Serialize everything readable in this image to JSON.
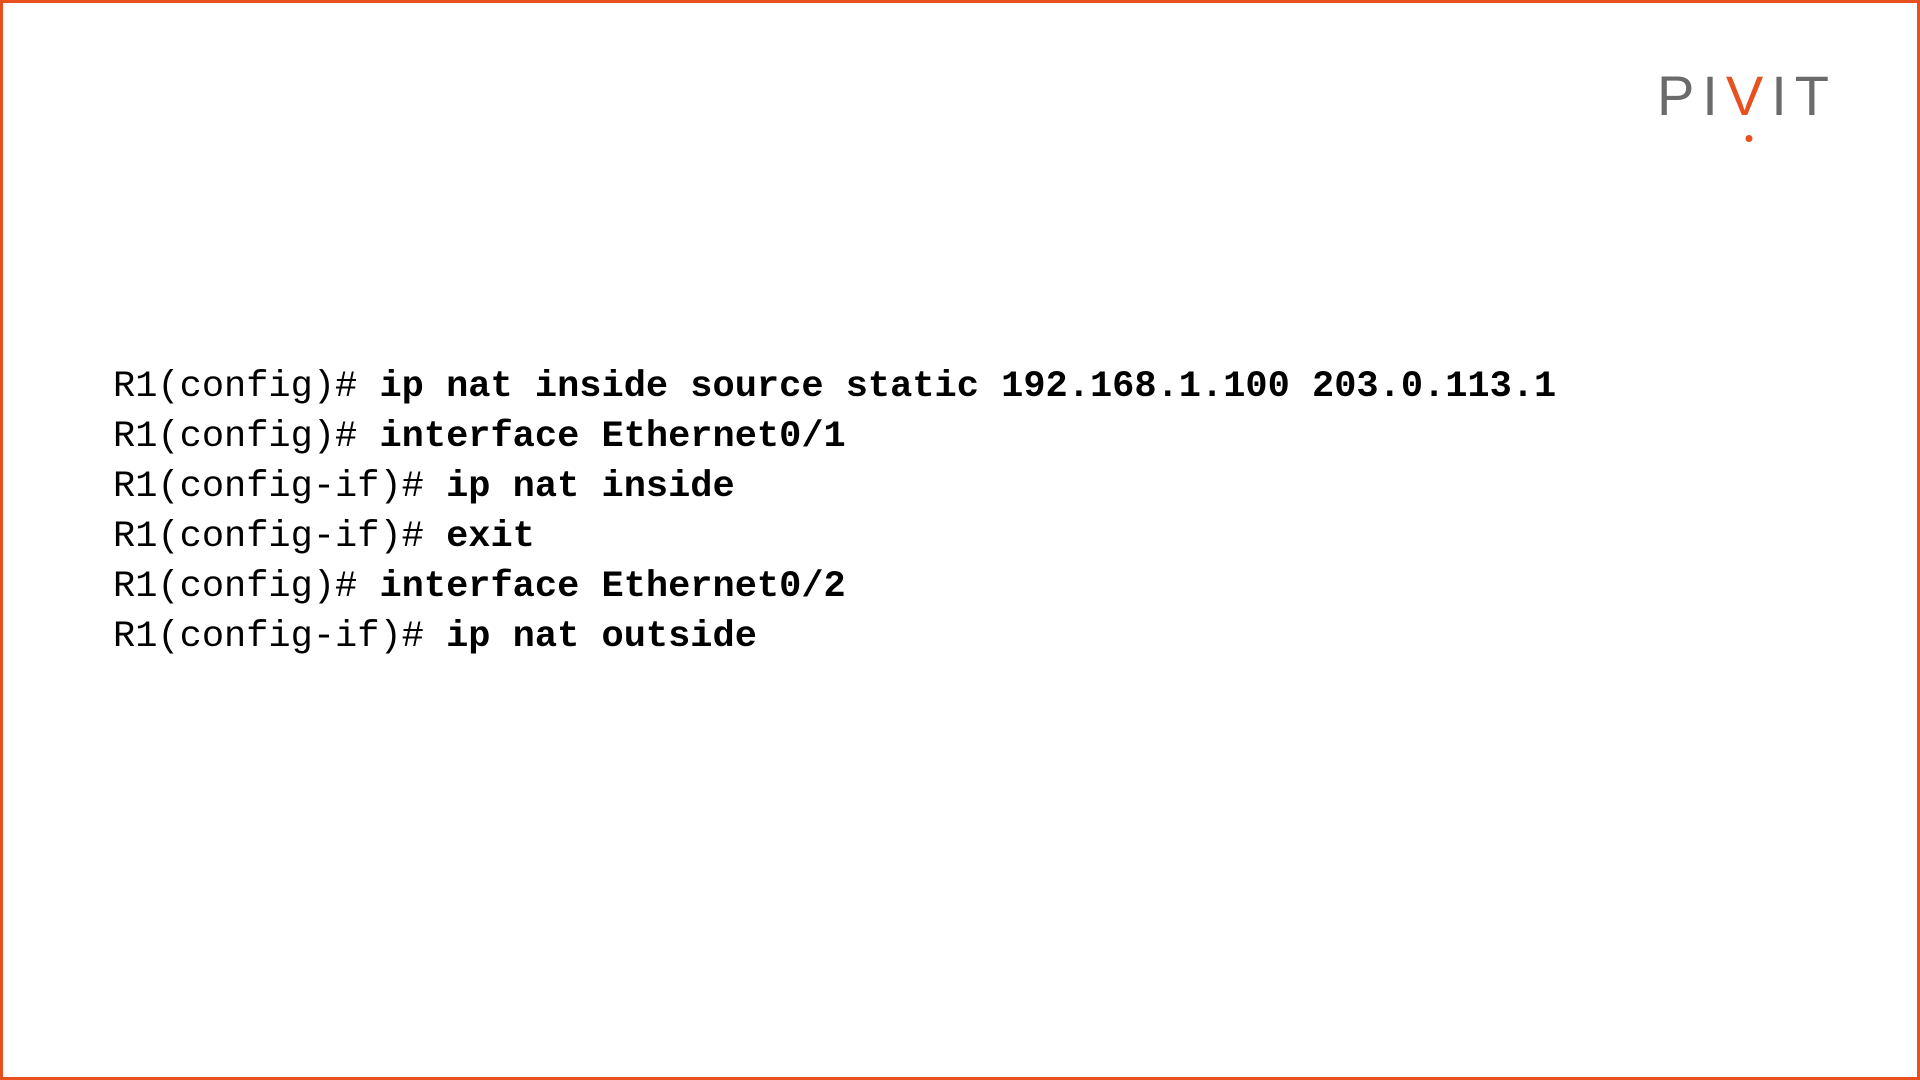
{
  "logo": {
    "p": "P",
    "i1": "I",
    "v": "V",
    "i2": "I",
    "t": "T"
  },
  "lines": [
    {
      "prompt": "R1(config)# ",
      "command": "ip nat inside source static 192.168.1.100 203.0.113.1"
    },
    {
      "prompt": "R1(config)# ",
      "command": "interface Ethernet0/1"
    },
    {
      "prompt": "R1(config-if)# ",
      "command": "ip nat inside"
    },
    {
      "prompt": "R1(config-if)# ",
      "command": "exit"
    },
    {
      "prompt": "R1(config)# ",
      "command": "interface Ethernet0/2"
    },
    {
      "prompt": "R1(config-if)# ",
      "command": "ip nat outside"
    }
  ]
}
